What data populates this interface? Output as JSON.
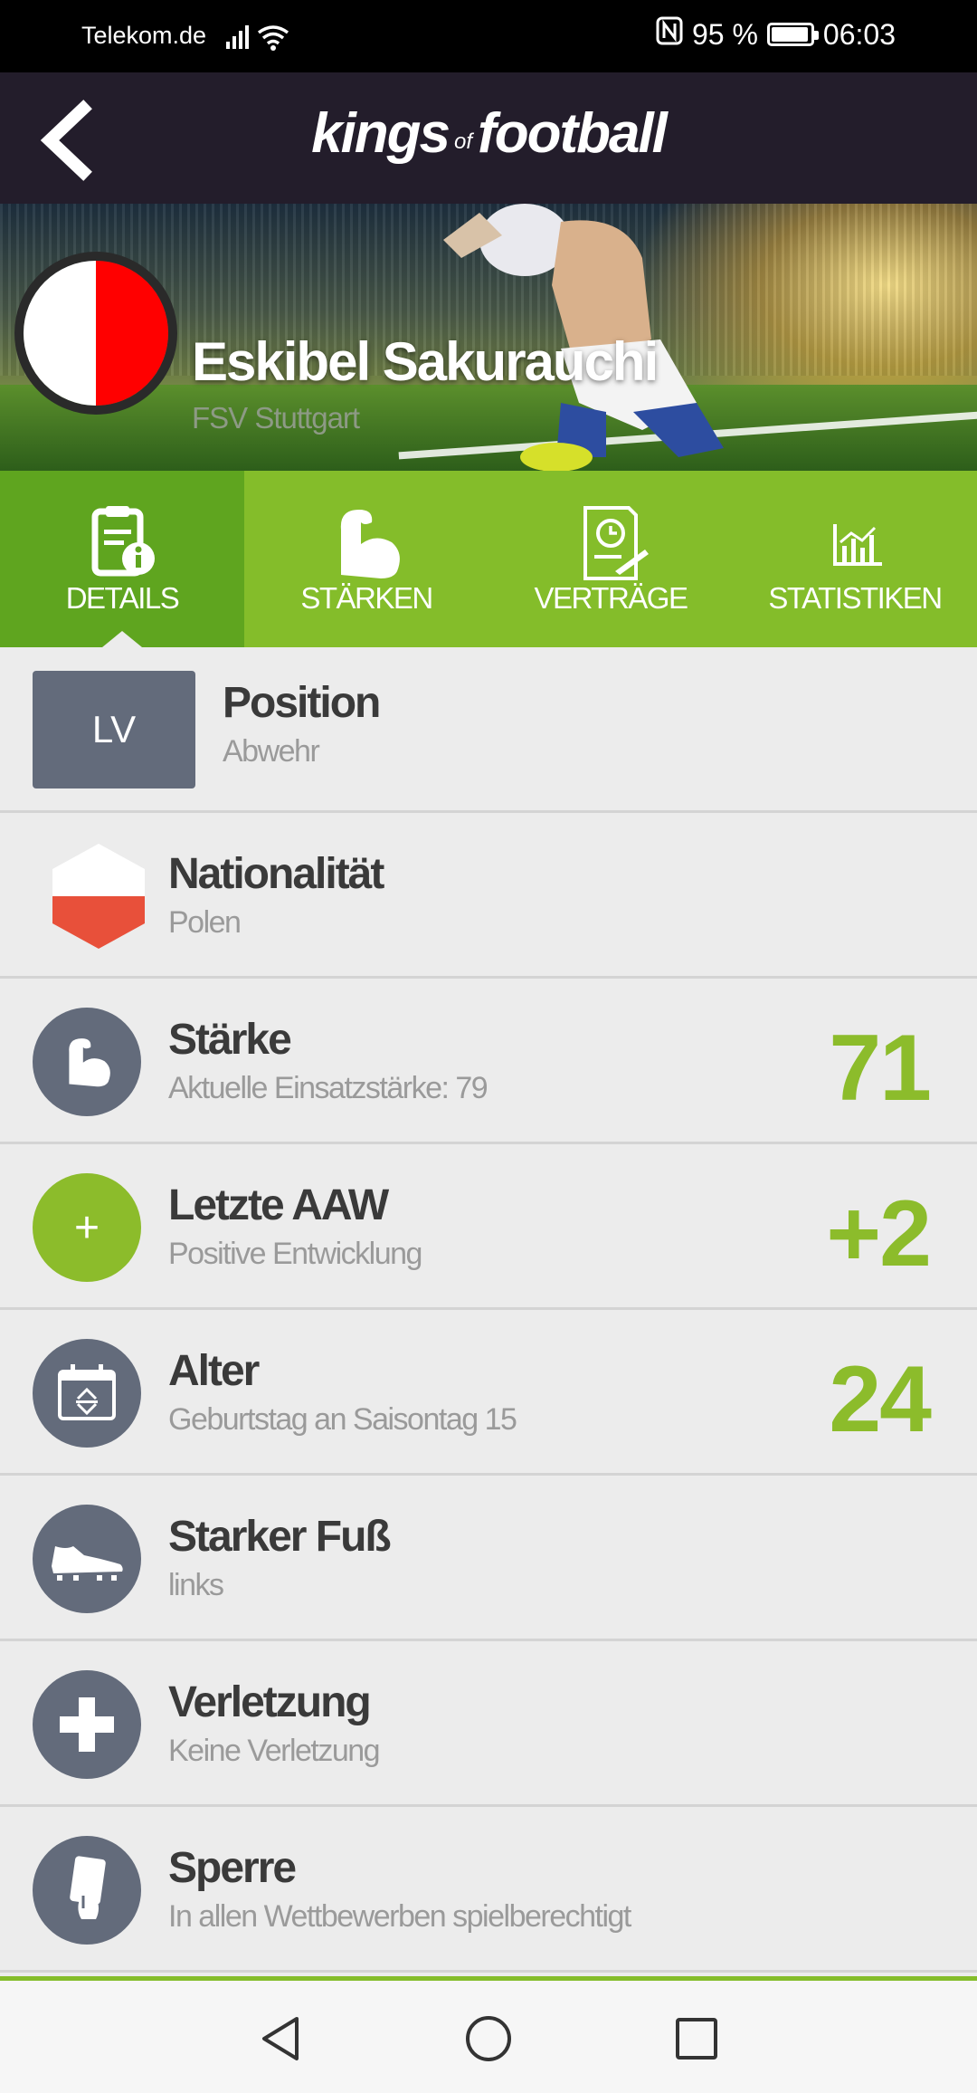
{
  "status_bar": {
    "carrier": "Telekom.de",
    "battery": "95 %",
    "battery_level": 0.95,
    "time": "06:03"
  },
  "header": {
    "logo_main_left": "kings",
    "logo_small": "of",
    "logo_main_right": "football"
  },
  "player": {
    "name": "Eskibel Sakurauchi",
    "club": "FSV Stuttgart",
    "club_colors": [
      "#ffffff",
      "#ff0000"
    ]
  },
  "tabs": [
    {
      "label": "DETAILS",
      "icon": "document-info-icon",
      "active": true
    },
    {
      "label": "STÄRKEN",
      "icon": "bicep-icon",
      "active": false
    },
    {
      "label": "VERTRÄGE",
      "icon": "contract-icon",
      "active": false
    },
    {
      "label": "STATISTIKEN",
      "icon": "bar-chart-icon",
      "active": false
    }
  ],
  "details": {
    "position": {
      "badge": "LV",
      "title": "Position",
      "subtitle": "Abwehr"
    },
    "nationality": {
      "title": "Nationalität",
      "subtitle": "Polen",
      "icon": "poland-flag-icon"
    },
    "strength": {
      "title": "Stärke",
      "subtitle": "Aktuelle Einsatzstärke: 79",
      "value": "71",
      "icon": "bicep-icon"
    },
    "last_aaw": {
      "title": "Letzte AAW",
      "subtitle": "Positive Entwicklung",
      "value": "+2",
      "icon_text": "+"
    },
    "age": {
      "title": "Alter",
      "subtitle": "Geburtstag an Saisontag 15",
      "value": "24",
      "icon": "calendar-icon"
    },
    "strong_foot": {
      "title": "Starker Fuß",
      "subtitle": "links",
      "icon": "football-boot-icon"
    },
    "injury": {
      "title": "Verletzung",
      "subtitle": "Keine Verletzung",
      "icon": "medical-cross-icon"
    },
    "suspension": {
      "title": "Sperre",
      "subtitle": "In allen Wettbewerben spielberechtigt",
      "icon": "referee-card-icon"
    }
  },
  "colors": {
    "accent_green": "#84bd2a",
    "active_tab": "#5fa51f",
    "value_green": "#8cbc2b",
    "header_bg": "#231d2b",
    "icon_circle": "#636b7b"
  }
}
